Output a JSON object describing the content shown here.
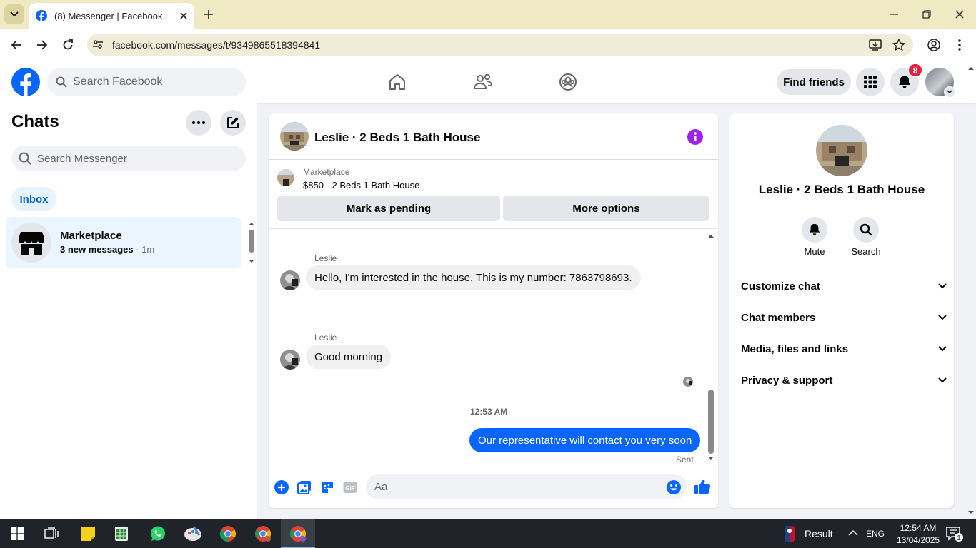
{
  "browser": {
    "tab_title": "(8) Messenger | Facebook",
    "url": "facebook.com/messages/t/9349865518394841"
  },
  "fb": {
    "search_placeholder": "Search Facebook",
    "find_friends": "Find friends",
    "notification_count": "8",
    "brand_color": "#0866ff"
  },
  "sidebar": {
    "title": "Chats",
    "search_placeholder": "Search Messenger",
    "filter": "Inbox",
    "conversations": [
      {
        "name": "Marketplace",
        "preview": "3 new messages",
        "separator": " · ",
        "time": "1m"
      }
    ]
  },
  "chat": {
    "title": "Leslie · 2 Beds 1 Bath House",
    "listing_label": "Marketplace",
    "listing_price": "$850 - 2 Beds 1 Bath House",
    "pending_button": "Mark as pending",
    "more_options_button": "More options",
    "messages": [
      {
        "sender": "Leslie",
        "text": "Hello, I'm interested in the house. This is my number: 7863798693.",
        "direction": "in"
      },
      {
        "sender": "Leslie",
        "text": "Good morning",
        "direction": "in"
      },
      {
        "timestamp": "12:53 AM",
        "text": "Our representative will contact you very soon",
        "direction": "out",
        "status": "Sent"
      }
    ],
    "composer_placeholder": "Aa"
  },
  "right_panel": {
    "name": "Leslie · 2 Beds 1 Bath House",
    "actions": [
      {
        "label": "Mute",
        "icon": "bell-icon"
      },
      {
        "label": "Search",
        "icon": "search-icon"
      }
    ],
    "sections": [
      "Customize chat",
      "Chat members",
      "Media, files and links",
      "Privacy & support"
    ]
  },
  "taskbar": {
    "widget_text": "Result",
    "language": "ENG",
    "time": "12:54 AM",
    "date": "13/04/2025",
    "notification_count": "1"
  }
}
